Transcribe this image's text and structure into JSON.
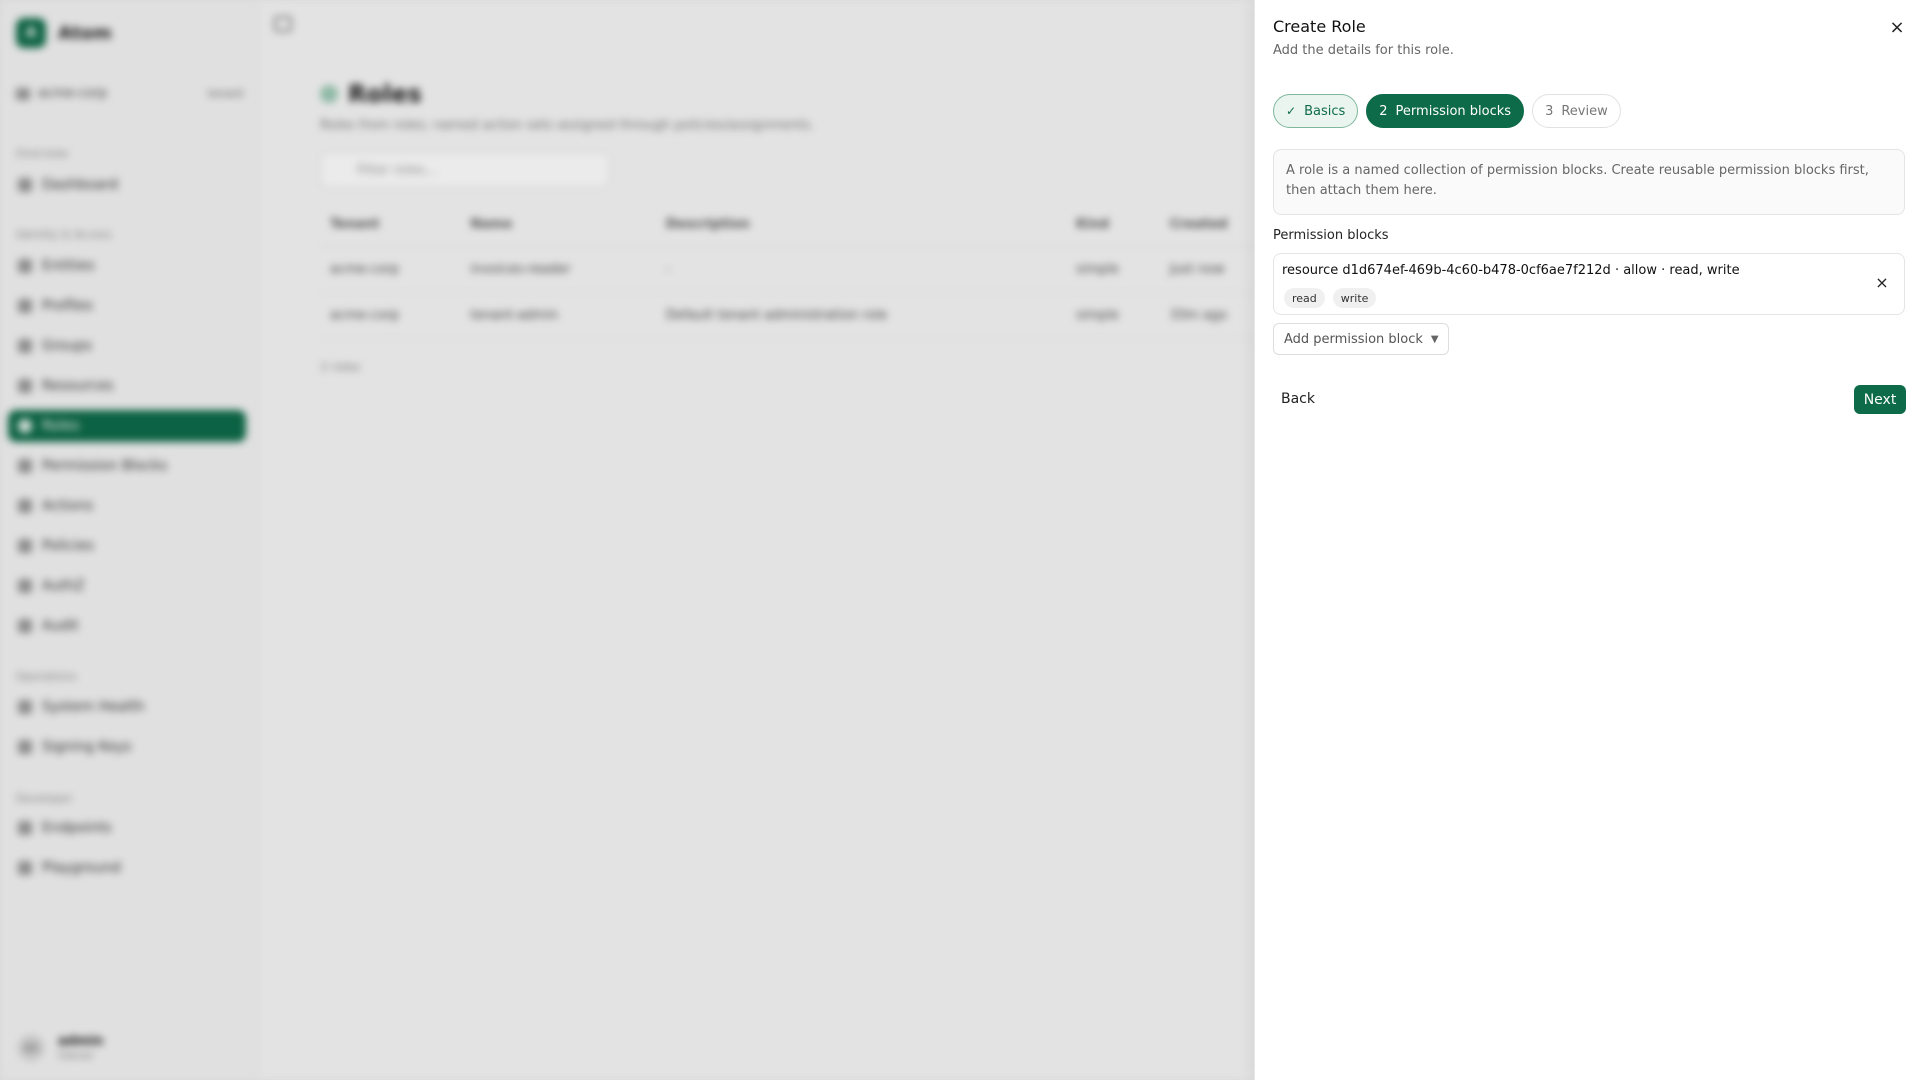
{
  "app": {
    "name": "Atom",
    "logo_letter": "A"
  },
  "tenant_switcher": {
    "tenant": "acme-corp",
    "tag": "tenant"
  },
  "nav": {
    "sections": [
      {
        "label": "Overview",
        "items": [
          "Dashboard"
        ]
      },
      {
        "label": "Identity & Access",
        "items": [
          "Entities",
          "Profiles",
          "Groups",
          "Resources",
          "Roles",
          "Permission Blocks",
          "Actions",
          "Policies",
          "AuthZ",
          "Audit"
        ]
      },
      {
        "label": "Operations",
        "items": [
          "System Health",
          "Signing Keys"
        ]
      },
      {
        "label": "Developer",
        "items": [
          "Endpoints",
          "Playground"
        ]
      }
    ],
    "active": "Roles"
  },
  "user": {
    "initials": "AD",
    "name": "admin",
    "role": "Owner"
  },
  "page": {
    "title": "Roles",
    "subtitle": "Roles from roles; named action sets assigned through policies/assignments.",
    "filter_placeholder": "Filter roles...",
    "columns": [
      "Tenant",
      "Name",
      "Description",
      "Kind",
      "Created"
    ],
    "rows": [
      [
        "acme-corp",
        "invoices-reader",
        "-",
        "simple",
        "Just now"
      ],
      [
        "acme-corp",
        "tenant-admin",
        "Default tenant administration role",
        "simple",
        "33m ago"
      ]
    ],
    "count": "2 roles"
  },
  "drawer": {
    "title": "Create Role",
    "subtitle": "Add the details for this role.",
    "close_label": "×",
    "steps": [
      {
        "label": "Basics",
        "state": "done"
      },
      {
        "number": "2",
        "label": "Permission blocks",
        "state": "current"
      },
      {
        "number": "3",
        "label": "Review",
        "state": "pending"
      }
    ],
    "info": "A role is a named collection of permission blocks. Create reusable permission blocks first, then attach them here.",
    "permission_blocks_label": "Permission blocks",
    "blocks": [
      {
        "title": "resource d1d674ef-469b-4c60-b478-0cf6ae7f212d · allow · read, write",
        "actions": [
          "read",
          "write"
        ]
      }
    ],
    "add_block_label": "Add permission block",
    "back_label": "Back",
    "next_label": "Next"
  },
  "colors": {
    "accent": "#0e6b4a",
    "accent_soft": "#eaf5ef"
  },
  "icons": {
    "close": "close-icon",
    "check": "check-icon",
    "chevron": "chevron-down-icon"
  }
}
